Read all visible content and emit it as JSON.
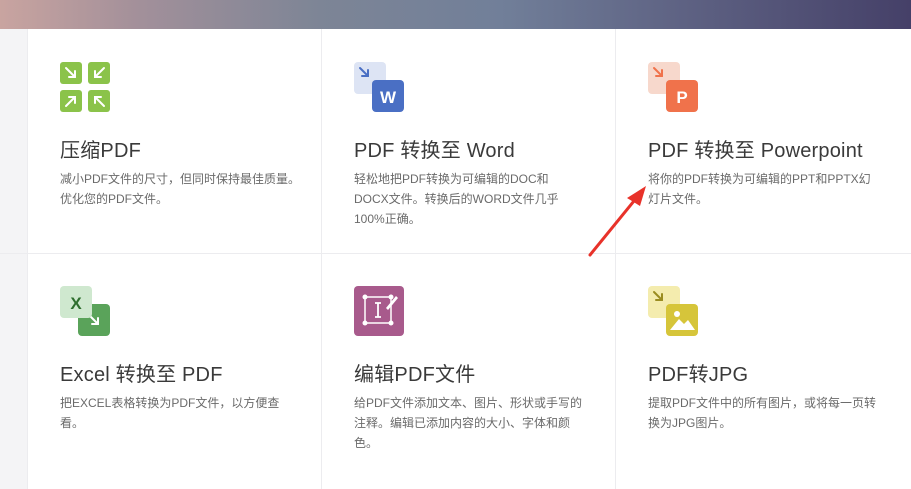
{
  "cards": [
    {
      "title": "压缩PDF",
      "desc": "减小PDF文件的尺寸，但同时保持最佳质量。优化您的PDF文件。",
      "icon": "compress-icon"
    },
    {
      "title": "PDF 转换至 Word",
      "desc": "轻松地把PDF转换为可编辑的DOC和DOCX文件。转换后的WORD文件几乎100%正确。",
      "icon": "pdf-to-word-icon",
      "badge": "W"
    },
    {
      "title": "PDF 转换至 Powerpoint",
      "desc": "将你的PDF转换为可编辑的PPT和PPTX幻灯片文件。",
      "icon": "pdf-to-powerpoint-icon",
      "badge": "P"
    },
    {
      "title": "Excel 转换至 PDF",
      "desc": "把EXCEL表格转换为PDF文件，以方便查看。",
      "icon": "excel-to-pdf-icon",
      "badge": "X"
    },
    {
      "title": "编辑PDF文件",
      "desc": "给PDF文件添加文本、图片、形状或手写的注释。编辑已添加内容的大小、字体和颜色。",
      "icon": "edit-pdf-icon"
    },
    {
      "title": "PDF转JPG",
      "desc": "提取PDF文件中的所有图片，或将每一页转换为JPG图片。",
      "icon": "pdf-to-jpg-icon"
    }
  ],
  "colors": {
    "compress": "#8bc34a",
    "word": "#4a6fc4",
    "powerpoint": "#f0724b",
    "excel": "#5aa35a",
    "edit": "#a85a8c",
    "jpg": "#d6c53a",
    "annotation_arrow": "#e8322a"
  }
}
